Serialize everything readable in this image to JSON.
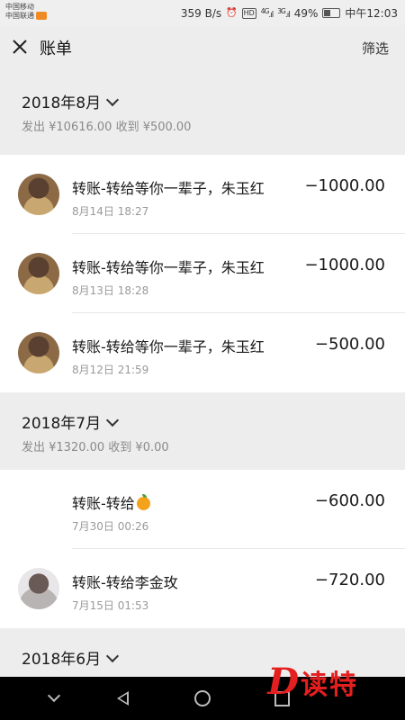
{
  "status": {
    "carrier1": "中国移动",
    "carrier2": "中国联通",
    "speed": "359 B/s",
    "hd": "HD",
    "net1": "4G",
    "net2": "3G",
    "battery": "49%",
    "time": "中午12:03"
  },
  "header": {
    "title": "账单",
    "filter": "筛选"
  },
  "months": [
    {
      "title": "2018年8月",
      "summary": "发出 ¥10616.00 收到 ¥500.00",
      "rows": [
        {
          "title": "转账-转给等你一辈子，朱玉红",
          "time": "8月14日 18:27",
          "amount": "−1000.00"
        },
        {
          "title": "转账-转给等你一辈子，朱玉红",
          "time": "8月13日 18:28",
          "amount": "−1000.00"
        },
        {
          "title": "转账-转给等你一辈子，朱玉红",
          "time": "8月12日 21:59",
          "amount": "−500.00"
        }
      ]
    },
    {
      "title": "2018年7月",
      "summary": "发出 ¥1320.00 收到 ¥0.00",
      "rows": [
        {
          "title": "转账-转给",
          "time": "7月30日 00:26",
          "amount": "−600.00",
          "icon": "orange-icon"
        },
        {
          "title": "转账-转给李金玫",
          "time": "7月15日 01:53",
          "amount": "−720.00"
        }
      ]
    },
    {
      "title": "2018年6月"
    }
  ],
  "watermark": {
    "letter": "D",
    "text": "读特"
  }
}
